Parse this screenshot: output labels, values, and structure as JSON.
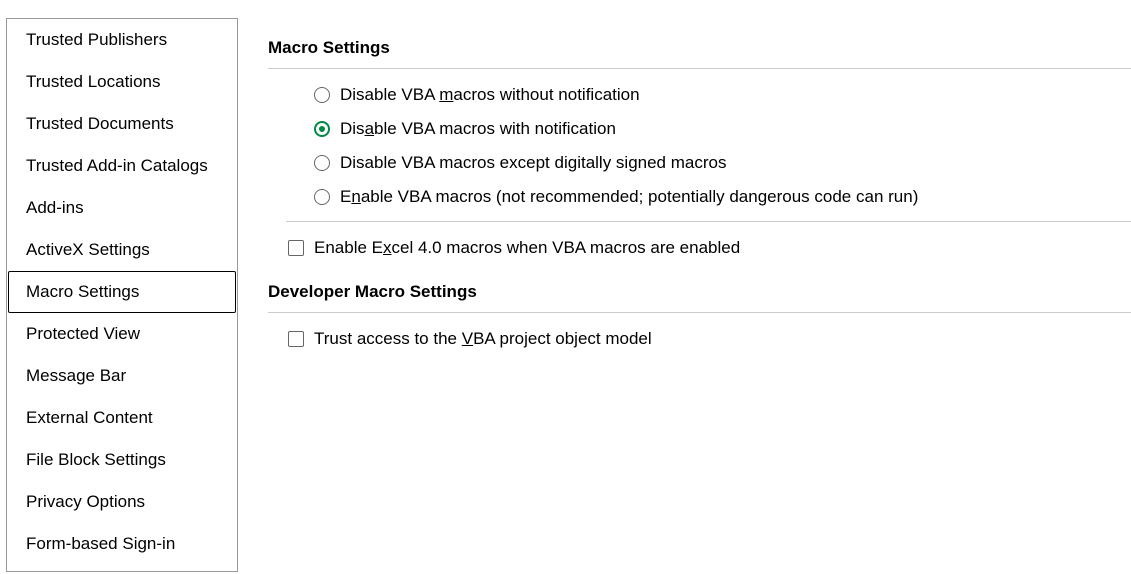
{
  "sidebar": {
    "items": [
      {
        "label": "Trusted Publishers",
        "selected": false
      },
      {
        "label": "Trusted Locations",
        "selected": false
      },
      {
        "label": "Trusted Documents",
        "selected": false
      },
      {
        "label": "Trusted Add-in Catalogs",
        "selected": false
      },
      {
        "label": "Add-ins",
        "selected": false
      },
      {
        "label": "ActiveX Settings",
        "selected": false
      },
      {
        "label": "Macro Settings",
        "selected": true
      },
      {
        "label": "Protected View",
        "selected": false
      },
      {
        "label": "Message Bar",
        "selected": false
      },
      {
        "label": "External Content",
        "selected": false
      },
      {
        "label": "File Block Settings",
        "selected": false
      },
      {
        "label": "Privacy Options",
        "selected": false
      },
      {
        "label": "Form-based Sign-in",
        "selected": false
      }
    ]
  },
  "main": {
    "section1_title": "Macro Settings",
    "radios": [
      {
        "pre": "Disable VBA ",
        "accel": "m",
        "post": "acros without notification",
        "checked": false
      },
      {
        "pre": "Dis",
        "accel": "a",
        "post": "ble VBA macros with notification",
        "checked": true
      },
      {
        "pre": "Disable VBA macros except di",
        "accel": "g",
        "post": "itally signed macros",
        "checked": false
      },
      {
        "pre": "E",
        "accel": "n",
        "post": "able VBA macros (not recommended; potentially dangerous code can run)",
        "checked": false
      }
    ],
    "check1": {
      "pre": "Enable E",
      "accel": "x",
      "post": "cel 4.0 macros when VBA macros are enabled",
      "checked": false
    },
    "section2_title": "Developer Macro Settings",
    "check2": {
      "pre": "Trust access to the ",
      "accel": "V",
      "post": "BA project object model",
      "checked": false
    }
  }
}
